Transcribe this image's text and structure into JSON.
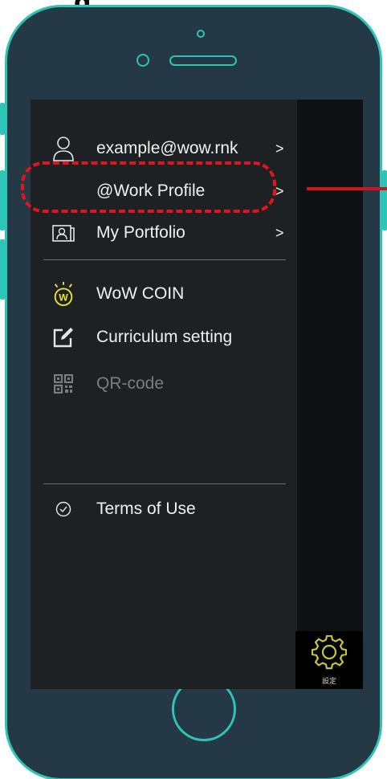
{
  "top_label": "g",
  "menu": {
    "account_email": "example@wow.rnk",
    "work_profile": "@Work Profile",
    "portfolio": "My Portfolio",
    "wow_coin": "WoW COIN",
    "curriculum": "Curriculum setting",
    "qr_code": "QR-code",
    "terms": "Terms of Use",
    "chevron": ">"
  },
  "settings": {
    "label": "設定"
  },
  "icons": {
    "account": "user-icon",
    "portfolio": "portfolio-icon",
    "coin": "coin-icon",
    "curriculum": "edit-icon",
    "qr": "qr-code-icon",
    "terms": "check-circle-icon",
    "settings": "gear-icon"
  },
  "colors": {
    "phone_body": "#253845",
    "phone_accent": "#2ec4b6",
    "drawer": "#1e2124",
    "coin_yellow": "#e9e534",
    "gear_yellow": "#c8c838",
    "highlight_red": "#e3141c"
  }
}
